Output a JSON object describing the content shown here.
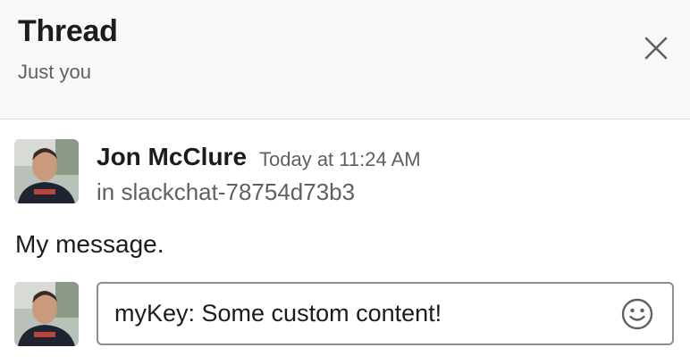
{
  "header": {
    "title": "Thread",
    "subtitle": "Just you",
    "close_icon": "close-icon"
  },
  "message": {
    "author": "Jon McClure",
    "timestamp": "Today at 11:24 AM",
    "channel": "in slackchat-78754d73b3",
    "text": "My message."
  },
  "composer": {
    "value": "myKey: Some custom content!",
    "emoji_icon": "emoji-smile-icon"
  },
  "colors": {
    "header_bg": "#f8f8f8",
    "text_primary": "#1d1c1d",
    "text_secondary": "#616061",
    "border": "#8d8d8d"
  }
}
